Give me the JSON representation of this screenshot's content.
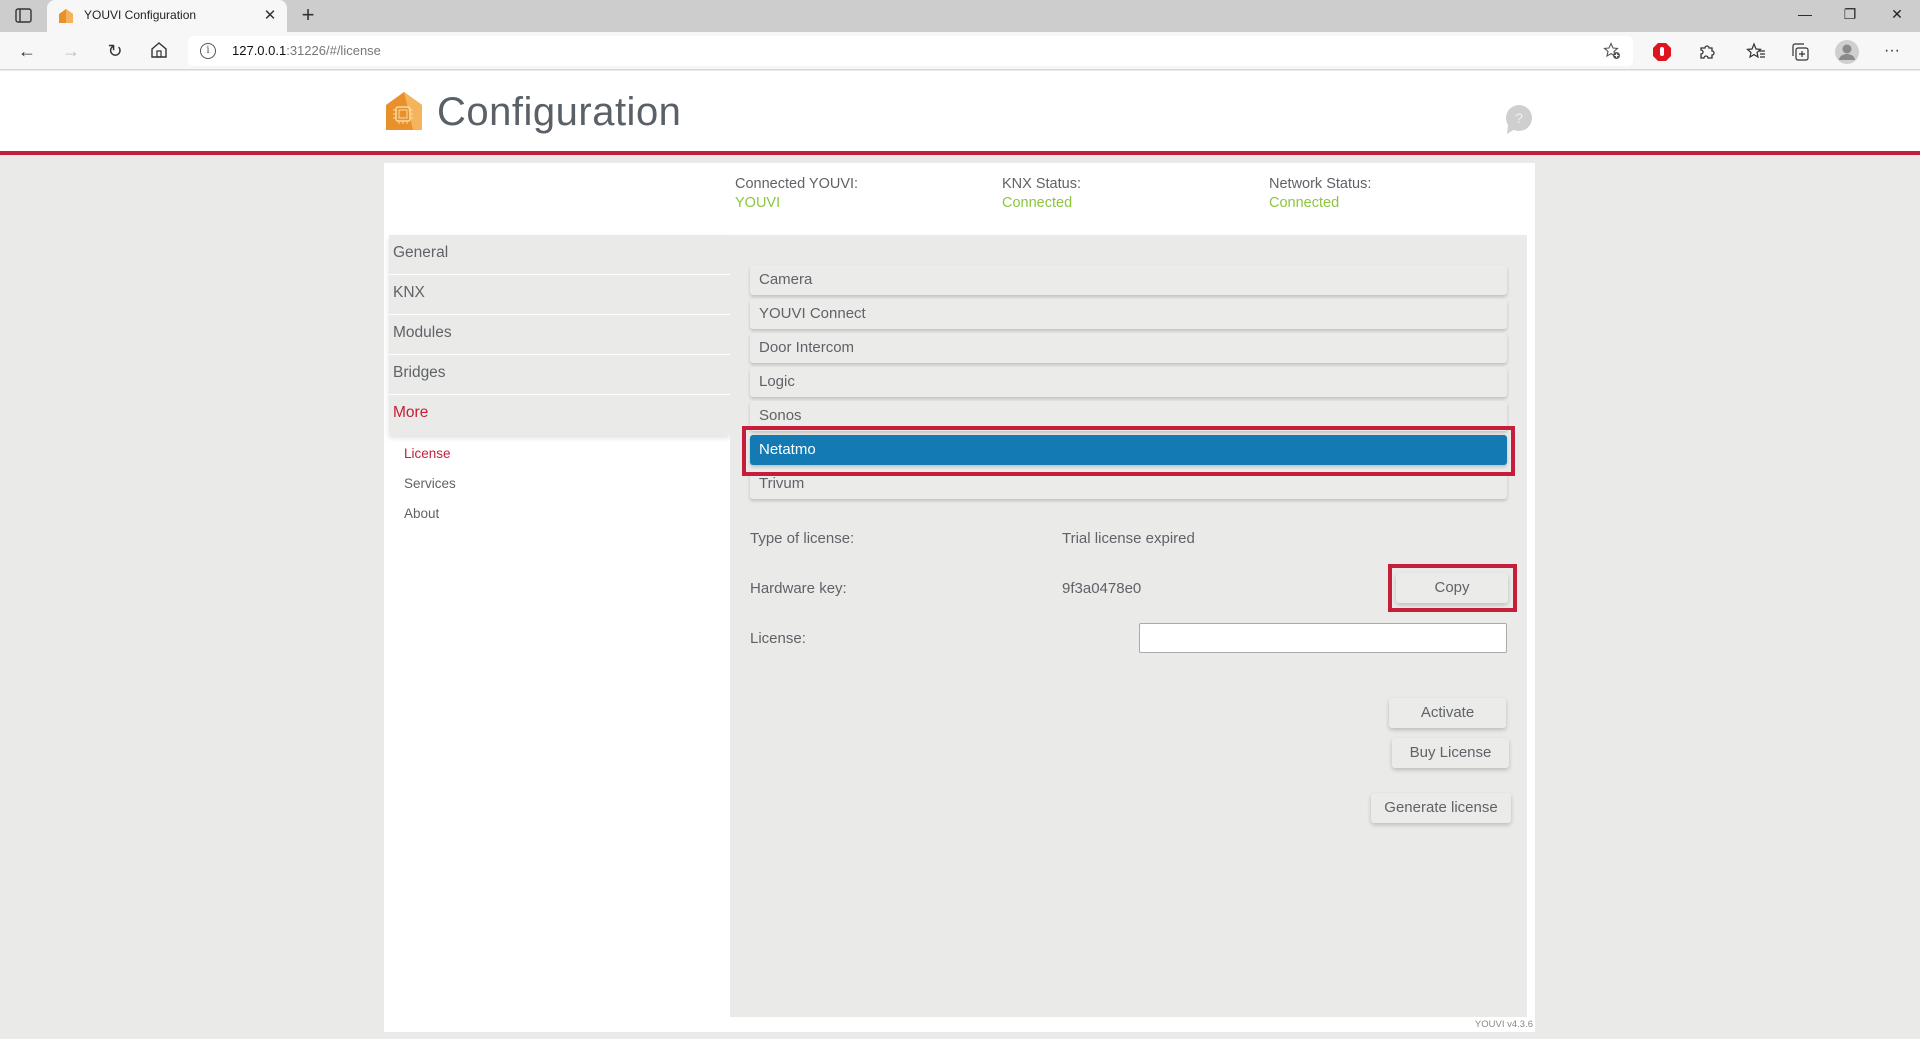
{
  "browser": {
    "tab_title": "YOUVI Configuration",
    "url_host": "127.0.0.1",
    "url_rest": ":31226/#/license"
  },
  "header": {
    "title": "Configuration"
  },
  "status": [
    {
      "label": "Connected YOUVI:",
      "value": "YOUVI"
    },
    {
      "label": "KNX Status:",
      "value": "Connected"
    },
    {
      "label": "Network Status:",
      "value": "Connected"
    }
  ],
  "colors": {
    "accent_red": "#c41e3a",
    "status_green": "#8cc63f",
    "selected_blue": "#137ab3"
  },
  "sidebar": {
    "items": [
      {
        "label": "General"
      },
      {
        "label": "KNX"
      },
      {
        "label": "Modules"
      },
      {
        "label": "Bridges"
      },
      {
        "label": "More",
        "active": true
      }
    ],
    "sub_items": [
      {
        "label": "License",
        "active": true
      },
      {
        "label": "Services"
      },
      {
        "label": "About"
      }
    ]
  },
  "modules": {
    "tabs": [
      {
        "label": "Camera"
      },
      {
        "label": "YOUVI Connect"
      },
      {
        "label": "Door Intercom"
      },
      {
        "label": "Logic"
      },
      {
        "label": "Sonos"
      },
      {
        "label": "Netatmo",
        "selected": true
      },
      {
        "label": "Trivum"
      }
    ]
  },
  "license": {
    "type_label": "Type of license:",
    "type_value": "Trial license expired",
    "hardware_label": "Hardware key:",
    "hardware_value": "9f3a0478e0",
    "copy_button": "Copy",
    "license_label": "License:",
    "license_input_value": "",
    "activate_button": "Activate",
    "buy_button": "Buy License",
    "generate_button": "Generate license"
  },
  "footer": {
    "version": "YOUVI v4.3.6"
  }
}
